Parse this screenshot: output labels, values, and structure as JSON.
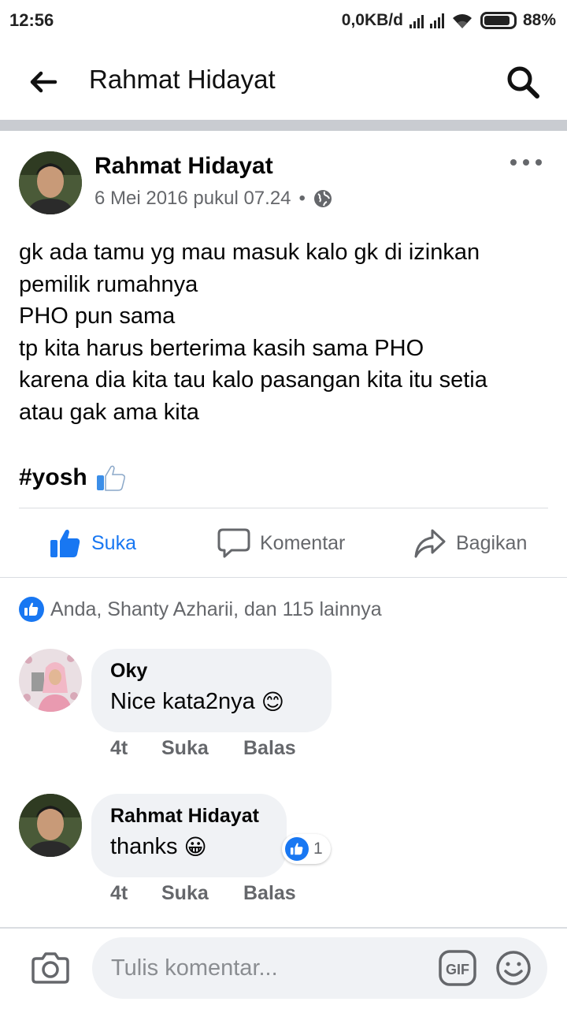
{
  "status_bar": {
    "time": "12:56",
    "network_speed": "0,0KB/d",
    "battery_percent": "88%",
    "battery_level": 0.88
  },
  "app_bar": {
    "title": "Rahmat Hidayat",
    "back_icon": "arrow-left-icon",
    "search_icon": "search-icon"
  },
  "post": {
    "author": "Rahmat Hidayat",
    "timestamp": "6 Mei 2016 pukul 07.24",
    "separator": "•",
    "privacy_icon": "globe-icon",
    "body": "gk ada tamu yg mau masuk kalo gk di izinkan\npemilik rumahnya\nPHO pun sama\ntp kita harus berterima kasih sama PHO\nkarena dia kita tau kalo pasangan kita itu setia\natau gak ama kita",
    "hashtag": "#yosh",
    "actions": {
      "like": "Suka",
      "comment": "Komentar",
      "share": "Bagikan"
    },
    "reactions_summary": "Anda, Shanty Azharii, dan 115 lainnya"
  },
  "comments": [
    {
      "author": "Oky",
      "text": "Nice kata2nya",
      "emoji": "😊",
      "time": "4t",
      "like_label": "Suka",
      "reply_label": "Balas"
    },
    {
      "author": "Rahmat Hidayat",
      "text": "thanks",
      "emoji": "😀",
      "time": "4t",
      "like_label": "Suka",
      "reply_label": "Balas",
      "reaction_count": "1"
    }
  ],
  "composer": {
    "placeholder": "Tulis komentar...",
    "gif_label": "GIF"
  },
  "colors": {
    "accent": "#1877f2",
    "secondary_text": "#65676b",
    "bubble": "#f0f2f5"
  }
}
